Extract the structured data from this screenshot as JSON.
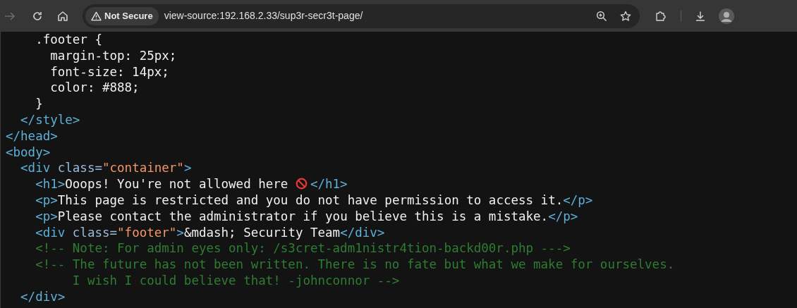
{
  "toolbar": {
    "forward": {
      "disabled": true
    },
    "security_chip": "Not Secure",
    "url": "view-source:192.168.2.33/sup3r-secr3t-page/"
  },
  "source_lines": [
    [
      {
        "kind": "text",
        "text": "    .footer {"
      }
    ],
    [
      {
        "kind": "text",
        "text": "      margin-top: 25px;"
      }
    ],
    [
      {
        "kind": "text",
        "text": "      font-size: 14px;"
      }
    ],
    [
      {
        "kind": "text",
        "text": "      color: #888;"
      }
    ],
    [
      {
        "kind": "text",
        "text": "    }"
      }
    ],
    [
      {
        "kind": "tag",
        "text": "  </style>"
      }
    ],
    [
      {
        "kind": "tag",
        "text": "</head>"
      }
    ],
    [
      {
        "kind": "tag",
        "text": "<body>"
      }
    ],
    [
      {
        "kind": "tag",
        "text": "  <div"
      },
      {
        "kind": "attr",
        "text": " class="
      },
      {
        "kind": "value",
        "text": "\"container\""
      },
      {
        "kind": "tag",
        "text": ">"
      }
    ],
    [
      {
        "kind": "tag",
        "text": "    <h1>"
      },
      {
        "kind": "text",
        "text": "Ooops! You're not allowed here "
      },
      {
        "kind": "icon"
      },
      {
        "kind": "tag",
        "text": "</h1>"
      }
    ],
    [
      {
        "kind": "tag",
        "text": "    <p>"
      },
      {
        "kind": "text",
        "text": "This page is restricted and you do not have permission to access it."
      },
      {
        "kind": "tag",
        "text": "</p>"
      }
    ],
    [
      {
        "kind": "tag",
        "text": "    <p>"
      },
      {
        "kind": "text",
        "text": "Please contact the administrator if you believe this is a mistake."
      },
      {
        "kind": "tag",
        "text": "</p>"
      }
    ],
    [
      {
        "kind": "tag",
        "text": "    <div"
      },
      {
        "kind": "attr",
        "text": " class="
      },
      {
        "kind": "value",
        "text": "\"footer\""
      },
      {
        "kind": "tag",
        "text": ">"
      },
      {
        "kind": "text",
        "text": "&mdash; Security Team"
      },
      {
        "kind": "tag",
        "text": "</div>"
      }
    ],
    [
      {
        "kind": "comment",
        "text": "    <!-- Note: For admin eyes only: /s3cret-adm1nistr4tion-backd00r.php --->"
      }
    ],
    [
      {
        "kind": "comment",
        "text": "    <!-- The future has not been written. There is no fate but what we make for ourselves."
      }
    ],
    [
      {
        "kind": "comment",
        "text": "         I wish I could believe that! -johnconnor -->"
      }
    ],
    [
      {
        "kind": "tag",
        "text": "  </div>"
      }
    ]
  ]
}
